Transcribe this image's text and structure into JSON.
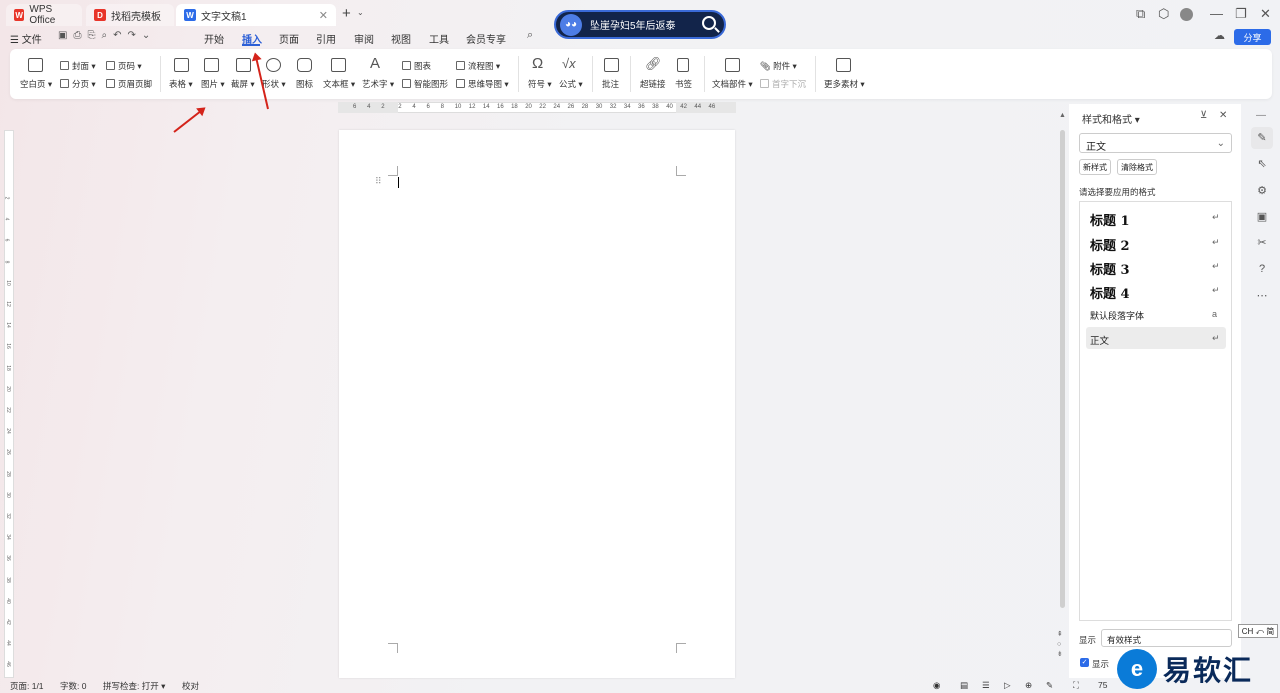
{
  "tabs": [
    {
      "label": "WPS Office",
      "icon": "wps-logo-icon",
      "color": "#e8352a"
    },
    {
      "label": "找稻壳模板",
      "icon": "docer-logo-icon",
      "color": "#e8352a"
    },
    {
      "label": "文字文稿1",
      "icon": "writer-doc-icon",
      "color": "#2c6be8"
    }
  ],
  "banner": {
    "text": "坠崖孕妇5年后返泰"
  },
  "menu": {
    "file": "文件",
    "items": [
      "开始",
      "插入",
      "页面",
      "引用",
      "审阅",
      "视图",
      "工具",
      "会员专享"
    ],
    "active": "插入",
    "share": "分享"
  },
  "ribbon": {
    "blank_page": "空白页",
    "cover": "封面",
    "page_break": "分页",
    "page_number": "页码",
    "header_footer": "页眉页脚",
    "table": "表格",
    "picture": "图片",
    "screenshot": "截屏",
    "shape": "形状",
    "icon": "图标",
    "textbox": "文本框",
    "wordart": "艺术字",
    "chart": "图表",
    "smart_shape": "智能图形",
    "flowchart": "流程图",
    "mindmap": "思维导图",
    "symbol": "符号",
    "formula": "公式",
    "comment": "批注",
    "hyperlink": "超链接",
    "bookmark": "书签",
    "doc_parts": "文档部件",
    "attachment": "附件",
    "drop_cap": "首字下沉",
    "more_material": "更多素材"
  },
  "ruler": {
    "numbers": [
      "6",
      "4",
      "2",
      "2",
      "4",
      "6",
      "8",
      "10",
      "12",
      "14",
      "16",
      "18",
      "20",
      "22",
      "24",
      "26",
      "28",
      "30",
      "32",
      "34",
      "36",
      "38",
      "40",
      "42",
      "44",
      "46"
    ],
    "vnumbers": [
      "2",
      "4",
      "6",
      "8",
      "10",
      "12",
      "14",
      "16",
      "18",
      "20",
      "22",
      "24",
      "26",
      "28",
      "30",
      "32",
      "34",
      "36",
      "38",
      "40",
      "42",
      "44",
      "46"
    ]
  },
  "style_panel": {
    "title": "样式和格式",
    "current": "正文",
    "new_style": "新样式",
    "clear_format": "清除格式",
    "prompt": "请选择要应用的格式",
    "styles": [
      "标题 1",
      "标题 2",
      "标题 3",
      "标题 4",
      "默认段落字体",
      "正文"
    ],
    "selected": "正文",
    "show_label": "显示",
    "show_value": "有效样式",
    "show_check": "显示"
  },
  "status": {
    "page": "页面: 1/1",
    "words": "字数: 0",
    "spellcheck": "拼写检查: 打开",
    "proofread": "校对",
    "zoom": "75"
  },
  "ime": "CH ⤺ 简",
  "watermark": {
    "text": "易软汇",
    "logo": "e"
  },
  "colors": {
    "accent": "#2c5fd6",
    "arrow": "#d4231a",
    "banner": "#12244a"
  }
}
